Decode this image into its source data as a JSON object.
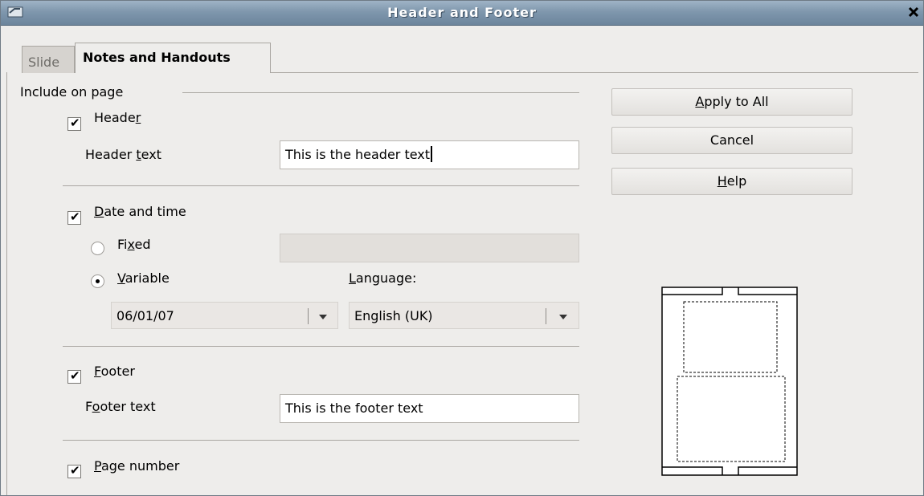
{
  "window": {
    "title": "Header and Footer"
  },
  "tabs": [
    {
      "label": "Slide",
      "active": false
    },
    {
      "label": "Notes and Handouts",
      "active": true
    }
  ],
  "section": {
    "label": "Include on page"
  },
  "header": {
    "checkbox_label_pre": "Heade",
    "checkbox_label_mnemonic": "r",
    "checked": true,
    "text_label_pre": "Header ",
    "text_label_mnemonic": "t",
    "text_label_post": "ext",
    "text_value": "This is the header text"
  },
  "datetime": {
    "checkbox_label_mnemonic": "D",
    "checkbox_label_post": "ate and time",
    "checked": true,
    "fixed_label_pre": "Fi",
    "fixed_label_mnemonic": "x",
    "fixed_label_post": "ed",
    "variable_label_mnemonic": "V",
    "variable_label_post": "ariable",
    "selected_mode": "Variable",
    "language_label_mnemonic": "L",
    "language_label_post": "anguage:",
    "date_format_value": "06/01/07",
    "language_value": "English (UK)"
  },
  "footer": {
    "checkbox_label_mnemonic": "F",
    "checkbox_label_post": "ooter",
    "checked": true,
    "text_label_pre": "F",
    "text_label_mnemonic": "o",
    "text_label_post": "oter text",
    "text_value": "This is the footer text"
  },
  "page_number": {
    "checkbox_label_mnemonic": "P",
    "checkbox_label_post": "age number",
    "checked": true
  },
  "buttons": {
    "apply_mnemonic": "A",
    "apply_post": "pply to All",
    "cancel": "Cancel",
    "help_mnemonic": "H",
    "help_post": "elp"
  },
  "icons": {
    "window": "window-menu-icon",
    "close": "close-icon",
    "dropdown": "chevron-down-icon"
  }
}
